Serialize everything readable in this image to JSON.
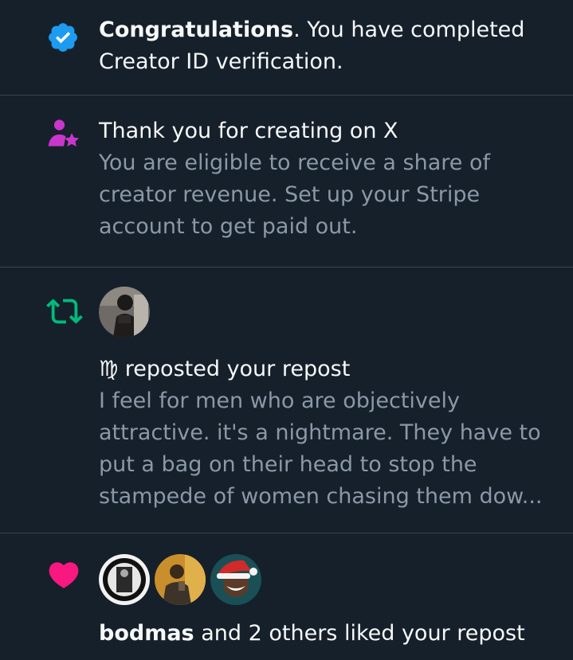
{
  "notifications": [
    {
      "icon": "verified-badge-icon",
      "icon_color": "#1d9bf0",
      "bold": "Congratulations",
      "text": ".  You have completed Creator ID verification."
    },
    {
      "icon": "creator-star-person-icon",
      "icon_color": "#c936cc",
      "title": "Thank you for creating on X",
      "body": "You are eligible to receive a share of creator revenue. Set up your Stripe account to get paid out."
    },
    {
      "icon": "repost-icon",
      "icon_color": "#00ba7c",
      "user": "♍",
      "action": " reposted your repost",
      "body": "I feel for men who are objectively attractive. it's a nightmare. They have to put a bag on their head to stop the stampede of women chasing them dow..."
    },
    {
      "icon": "heart-icon",
      "icon_color": "#f91880",
      "user": "bodmas",
      "action": " and 2 others liked your repost"
    }
  ]
}
